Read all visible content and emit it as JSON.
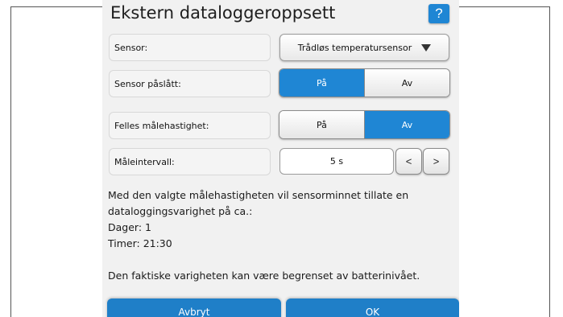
{
  "dialog": {
    "title": "Ekstern dataloggeroppsett",
    "help_label": "?"
  },
  "sensor": {
    "label": "Sensor:",
    "selected": "Trådløs temperatursensor"
  },
  "sensor_on": {
    "label": "Sensor påslått:",
    "options": [
      "På",
      "Av"
    ],
    "selected": "På"
  },
  "common_rate": {
    "label": "Felles målehastighet:",
    "options": [
      "På",
      "Av"
    ],
    "selected": "Av"
  },
  "interval": {
    "label": "Måleintervall:",
    "value": "5 s",
    "prev_label": "<",
    "next_label": ">"
  },
  "info": {
    "line1": "Med den valgte målehastigheten vil sensorminnet tillate en",
    "line2": "dataloggingsvarighet på ca.:",
    "days": "Dager: 1",
    "hours": "Timer: 21:30",
    "note": "Den faktiske varigheten kan være begrenset av batterinivået."
  },
  "footer": {
    "cancel_label": "Avbryt",
    "ok_label": "OK"
  },
  "colors": {
    "accent": "#1f86d4",
    "panel_bg": "#f1f1f1"
  }
}
